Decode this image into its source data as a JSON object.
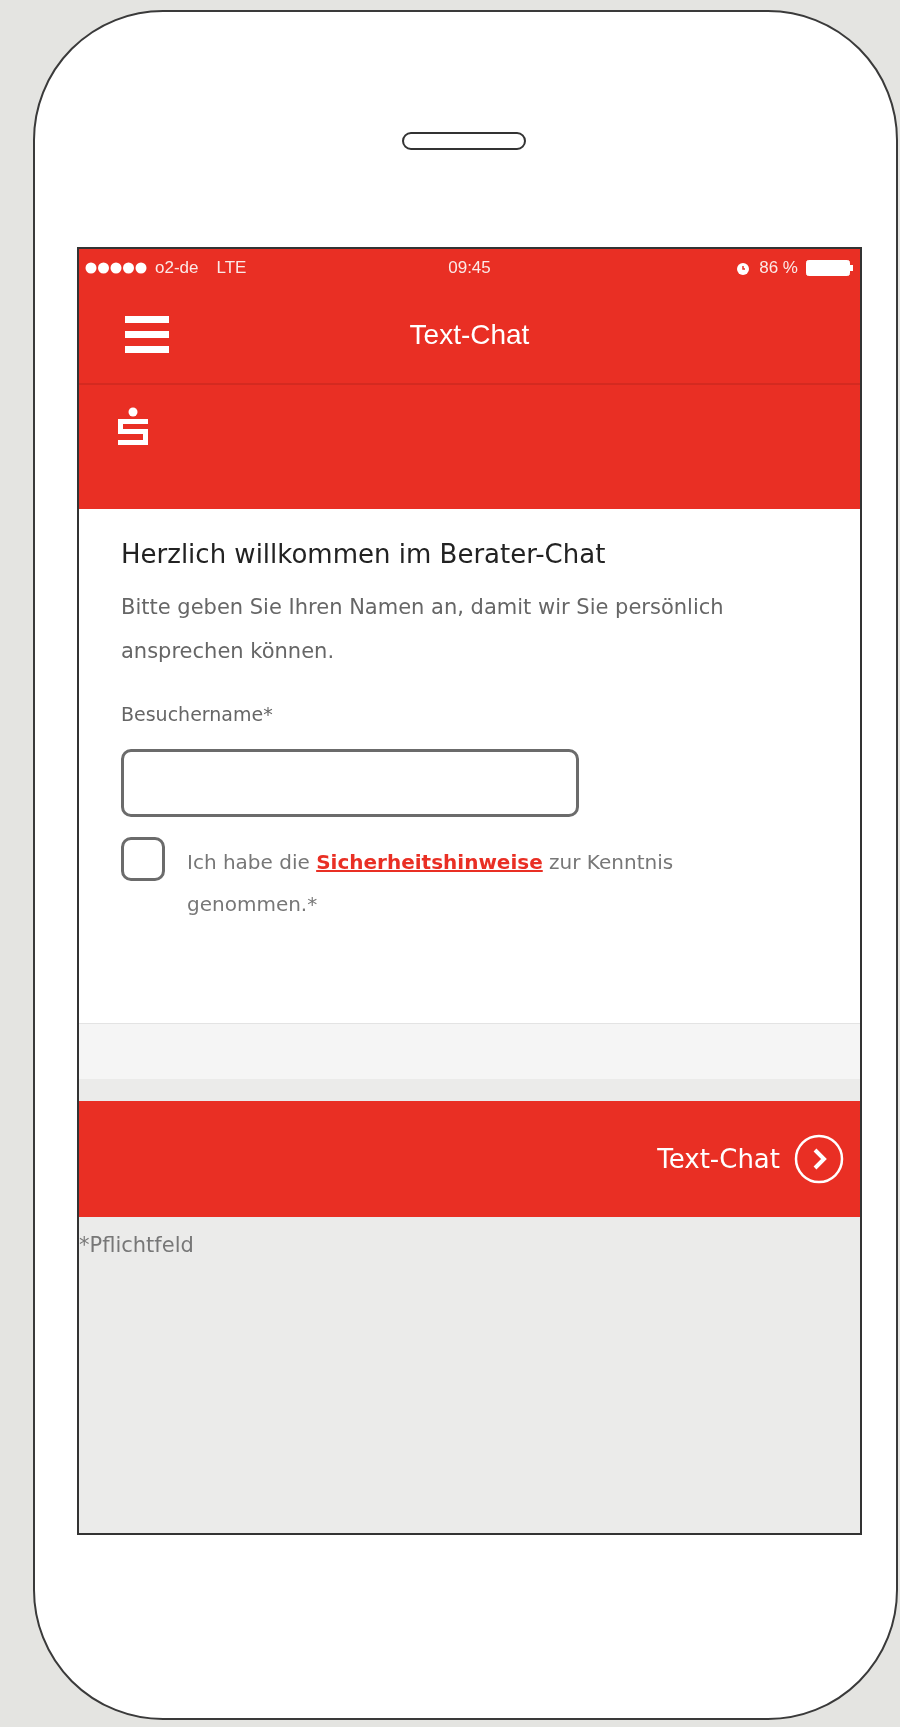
{
  "status_bar": {
    "carrier": "o2-de",
    "network": "LTE",
    "time": "09:45",
    "battery": "86 %"
  },
  "nav_bar": {
    "title": "Text-Chat"
  },
  "form": {
    "heading": "Herzlich willkommen im Berater-Chat",
    "intro": "Bitte geben Sie Ihren Namen an, damit wir Sie persönlich ansprechen können.",
    "name_label": "Besuchername*",
    "consent": {
      "checked": false,
      "before": "Ich habe die",
      "link": "Sicherheitshinweise",
      "after": "zur Kenntnis genommen.*"
    }
  },
  "action_bar": {
    "button": "Text-Chat"
  },
  "footnote": "*Pflichtfeld"
}
